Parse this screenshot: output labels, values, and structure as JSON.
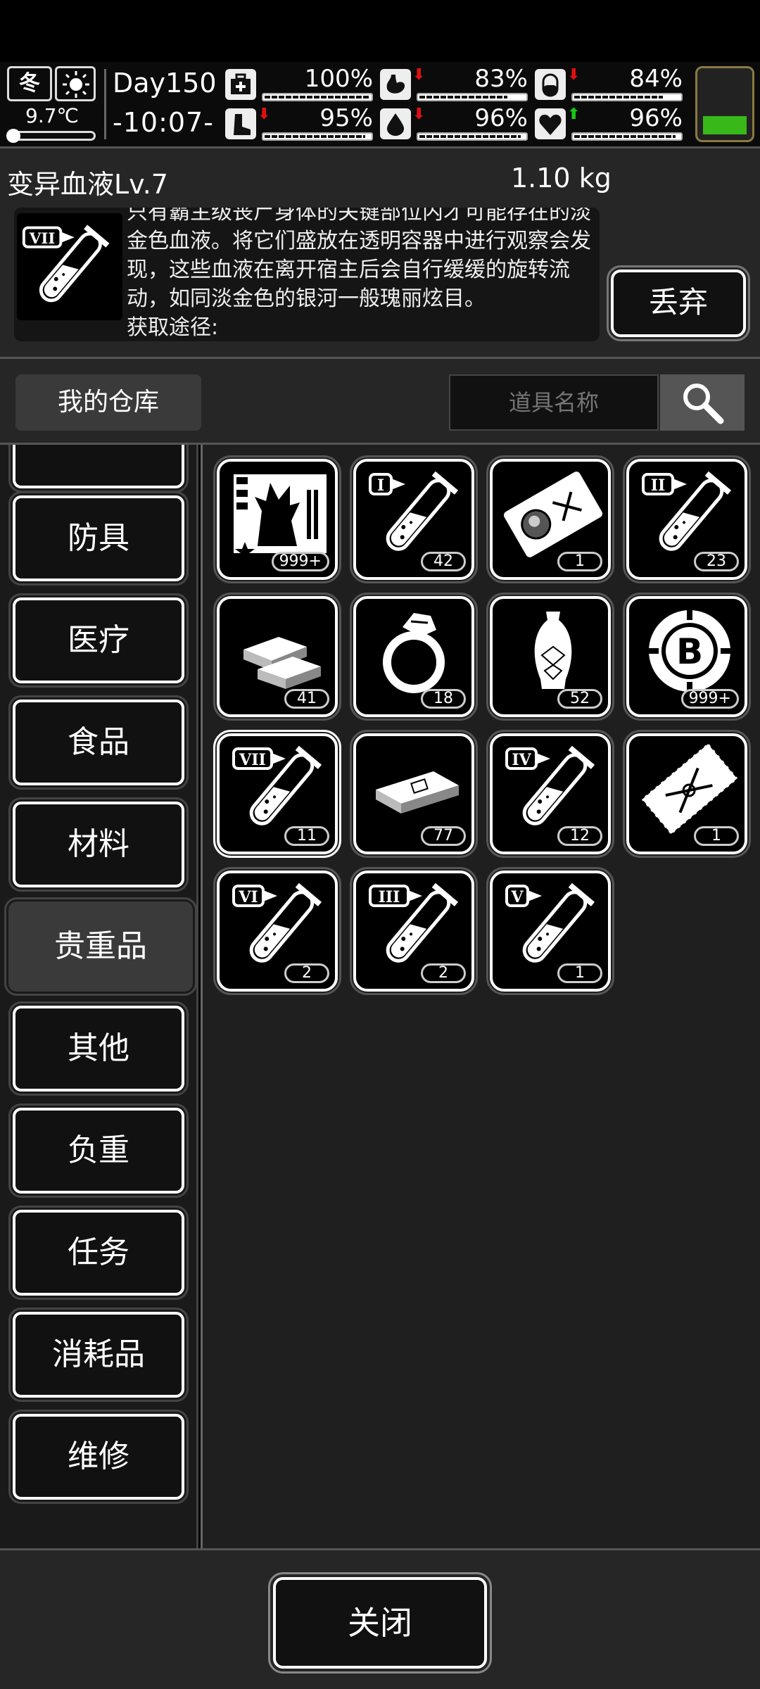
{
  "status": {
    "season": "冬",
    "weather_icon": "sun-icon",
    "temperature": "9.7℃",
    "temperature_level": 0.1,
    "day": "Day150",
    "time": "-10:07-",
    "stats": [
      {
        "name": "health",
        "icon": "medkit-icon",
        "value": "100%",
        "level": 1.0,
        "trend": ""
      },
      {
        "name": "hunger",
        "icon": "stomach-icon",
        "value": "83%",
        "level": 0.83,
        "trend": "down"
      },
      {
        "name": "stamina",
        "icon": "capsule-icon",
        "value": "84%",
        "level": 0.84,
        "trend": "down"
      },
      {
        "name": "leg",
        "icon": "boot-icon",
        "value": "95%",
        "level": 0.95,
        "trend": "down"
      },
      {
        "name": "water",
        "icon": "droplet-icon",
        "value": "96%",
        "level": 0.96,
        "trend": "down"
      },
      {
        "name": "mood",
        "icon": "heart-icon",
        "value": "96%",
        "level": 0.96,
        "trend": "up"
      }
    ],
    "trend_colors": {
      "down": "#e01010",
      "up": "#17c717"
    },
    "battery_color": "#39b81a"
  },
  "detail": {
    "name": "变异血液Lv.7",
    "weight": "1.10 kg",
    "icon": "blood-vial-vii-icon",
    "description": "只有霸主级丧尸身体的关键部位内才可能存在的淡金色血液。将它们盛放在透明容器中进行观察会发现，这些血液在离开宿主后会自行缓缓的旋转流动，如同淡金色的银河一般瑰丽炫目。\n获取途径:",
    "discard_label": "丢弃"
  },
  "warehouse": {
    "title": "我的仓库",
    "search_placeholder": "道具名称"
  },
  "categories": [
    "防具",
    "医疗",
    "食品",
    "材料",
    "贵重品",
    "其他",
    "负重",
    "任务",
    "消耗品",
    "维修"
  ],
  "active_category": "贵重品",
  "items": [
    {
      "icon": "zombie-poster-icon",
      "count": "999+"
    },
    {
      "icon": "blood-vial-i-icon",
      "count": "42"
    },
    {
      "icon": "bounty-ticket-icon",
      "count": "1"
    },
    {
      "icon": "blood-vial-ii-icon",
      "count": "23"
    },
    {
      "icon": "gold-bars-icon",
      "count": "41"
    },
    {
      "icon": "diamond-ring-icon",
      "count": "18"
    },
    {
      "icon": "porcelain-vase-icon",
      "count": "52"
    },
    {
      "icon": "bitcoin-chip-icon",
      "count": "999+"
    },
    {
      "icon": "blood-vial-vii-icon",
      "count": "11",
      "selected": true
    },
    {
      "icon": "cash-bundle-icon",
      "count": "77"
    },
    {
      "icon": "blood-vial-iv-icon",
      "count": "12"
    },
    {
      "icon": "admission-ticket-icon",
      "count": "1"
    },
    {
      "icon": "blood-vial-vi-icon",
      "count": "2"
    },
    {
      "icon": "blood-vial-iii-icon",
      "count": "2"
    },
    {
      "icon": "blood-vial-v-icon",
      "count": "1"
    }
  ],
  "vial_labels": {
    "blood-vial-i-icon": "I",
    "blood-vial-ii-icon": "II",
    "blood-vial-iii-icon": "III",
    "blood-vial-iv-icon": "IV",
    "blood-vial-v-icon": "V",
    "blood-vial-vi-icon": "VI",
    "blood-vial-vii-icon": "VII"
  },
  "close_label": "关闭"
}
